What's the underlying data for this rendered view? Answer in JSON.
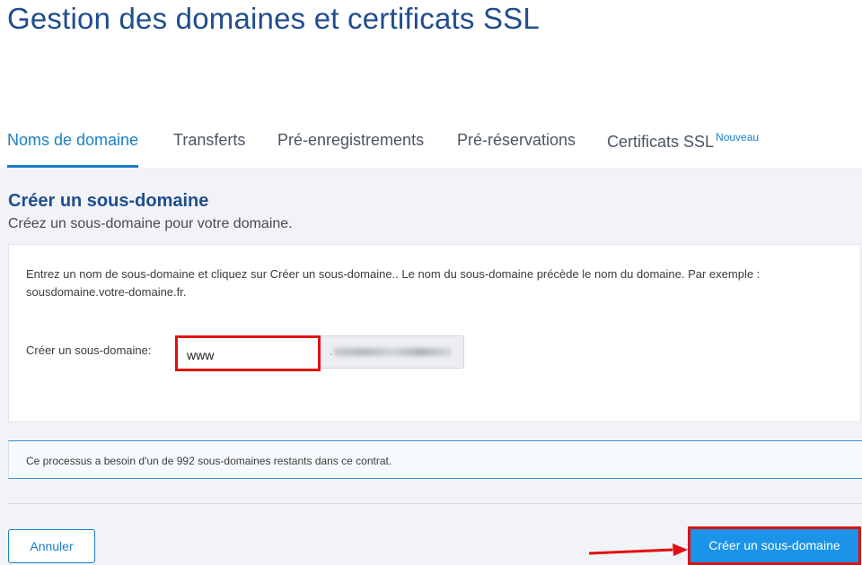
{
  "header": {
    "title": "Gestion des domaines et certificats SSL"
  },
  "tabs": [
    {
      "label": "Noms de domaine",
      "active": true
    },
    {
      "label": "Transferts",
      "active": false
    },
    {
      "label": "Pré-enregistrements",
      "active": false
    },
    {
      "label": "Pré-réservations",
      "active": false
    },
    {
      "label": "Certificats SSL",
      "active": false,
      "badge": "Nouveau"
    }
  ],
  "section": {
    "title": "Créer un sous-domaine",
    "subtitle": "Créez un sous-domaine pour votre domaine."
  },
  "form": {
    "help_text": "Entrez un nom de sous-domaine et cliquez sur Créer un sous-domaine.. Le nom du sous-domaine précède le nom du domaine. Par exemple : sousdomaine.votre-domaine.fr.",
    "field_label": "Créer un sous-domaine:",
    "subdomain_value": "www",
    "domain_prefix": "."
  },
  "info": {
    "text": "Ce processus a besoin d'un de 992 sous-domaines restants dans ce contrat."
  },
  "actions": {
    "cancel_label": "Annuler",
    "create_label": "Créer un sous-domaine"
  },
  "colors": {
    "brand_blue": "#1a7fc8",
    "title_blue": "#1f4d8f",
    "primary_button": "#1a93e8",
    "annotation_red": "#e01010"
  }
}
